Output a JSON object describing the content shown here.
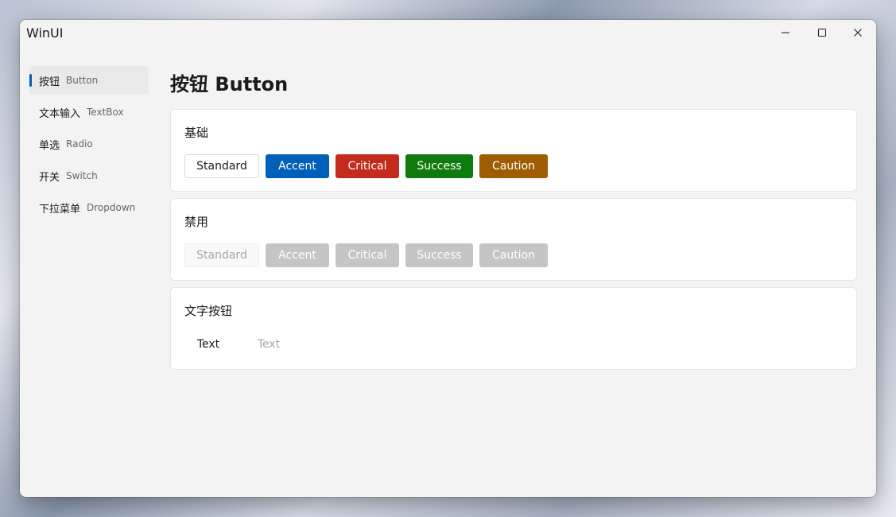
{
  "window": {
    "title": "WinUI"
  },
  "sidebar": {
    "items": [
      {
        "zh": "按钮",
        "en": "Button",
        "active": true
      },
      {
        "zh": "文本输入",
        "en": "TextBox",
        "active": false
      },
      {
        "zh": "单选",
        "en": "Radio",
        "active": false
      },
      {
        "zh": "开关",
        "en": "Switch",
        "active": false
      },
      {
        "zh": "下拉菜单",
        "en": "Dropdown",
        "active": false
      }
    ]
  },
  "main": {
    "title": "按钮 Button",
    "sections": [
      {
        "title": "基础",
        "buttons": [
          "Standard",
          "Accent",
          "Critical",
          "Success",
          "Caution"
        ]
      },
      {
        "title": "禁用",
        "buttons": [
          "Standard",
          "Accent",
          "Critical",
          "Success",
          "Caution"
        ]
      },
      {
        "title": "文字按钮",
        "buttons": [
          "Text",
          "Text"
        ]
      }
    ]
  },
  "colors": {
    "accent": "#005fb8",
    "critical": "#c42b1c",
    "success": "#0f7b0f",
    "caution": "#9d5d00",
    "disabled": "#c5c5c5"
  }
}
